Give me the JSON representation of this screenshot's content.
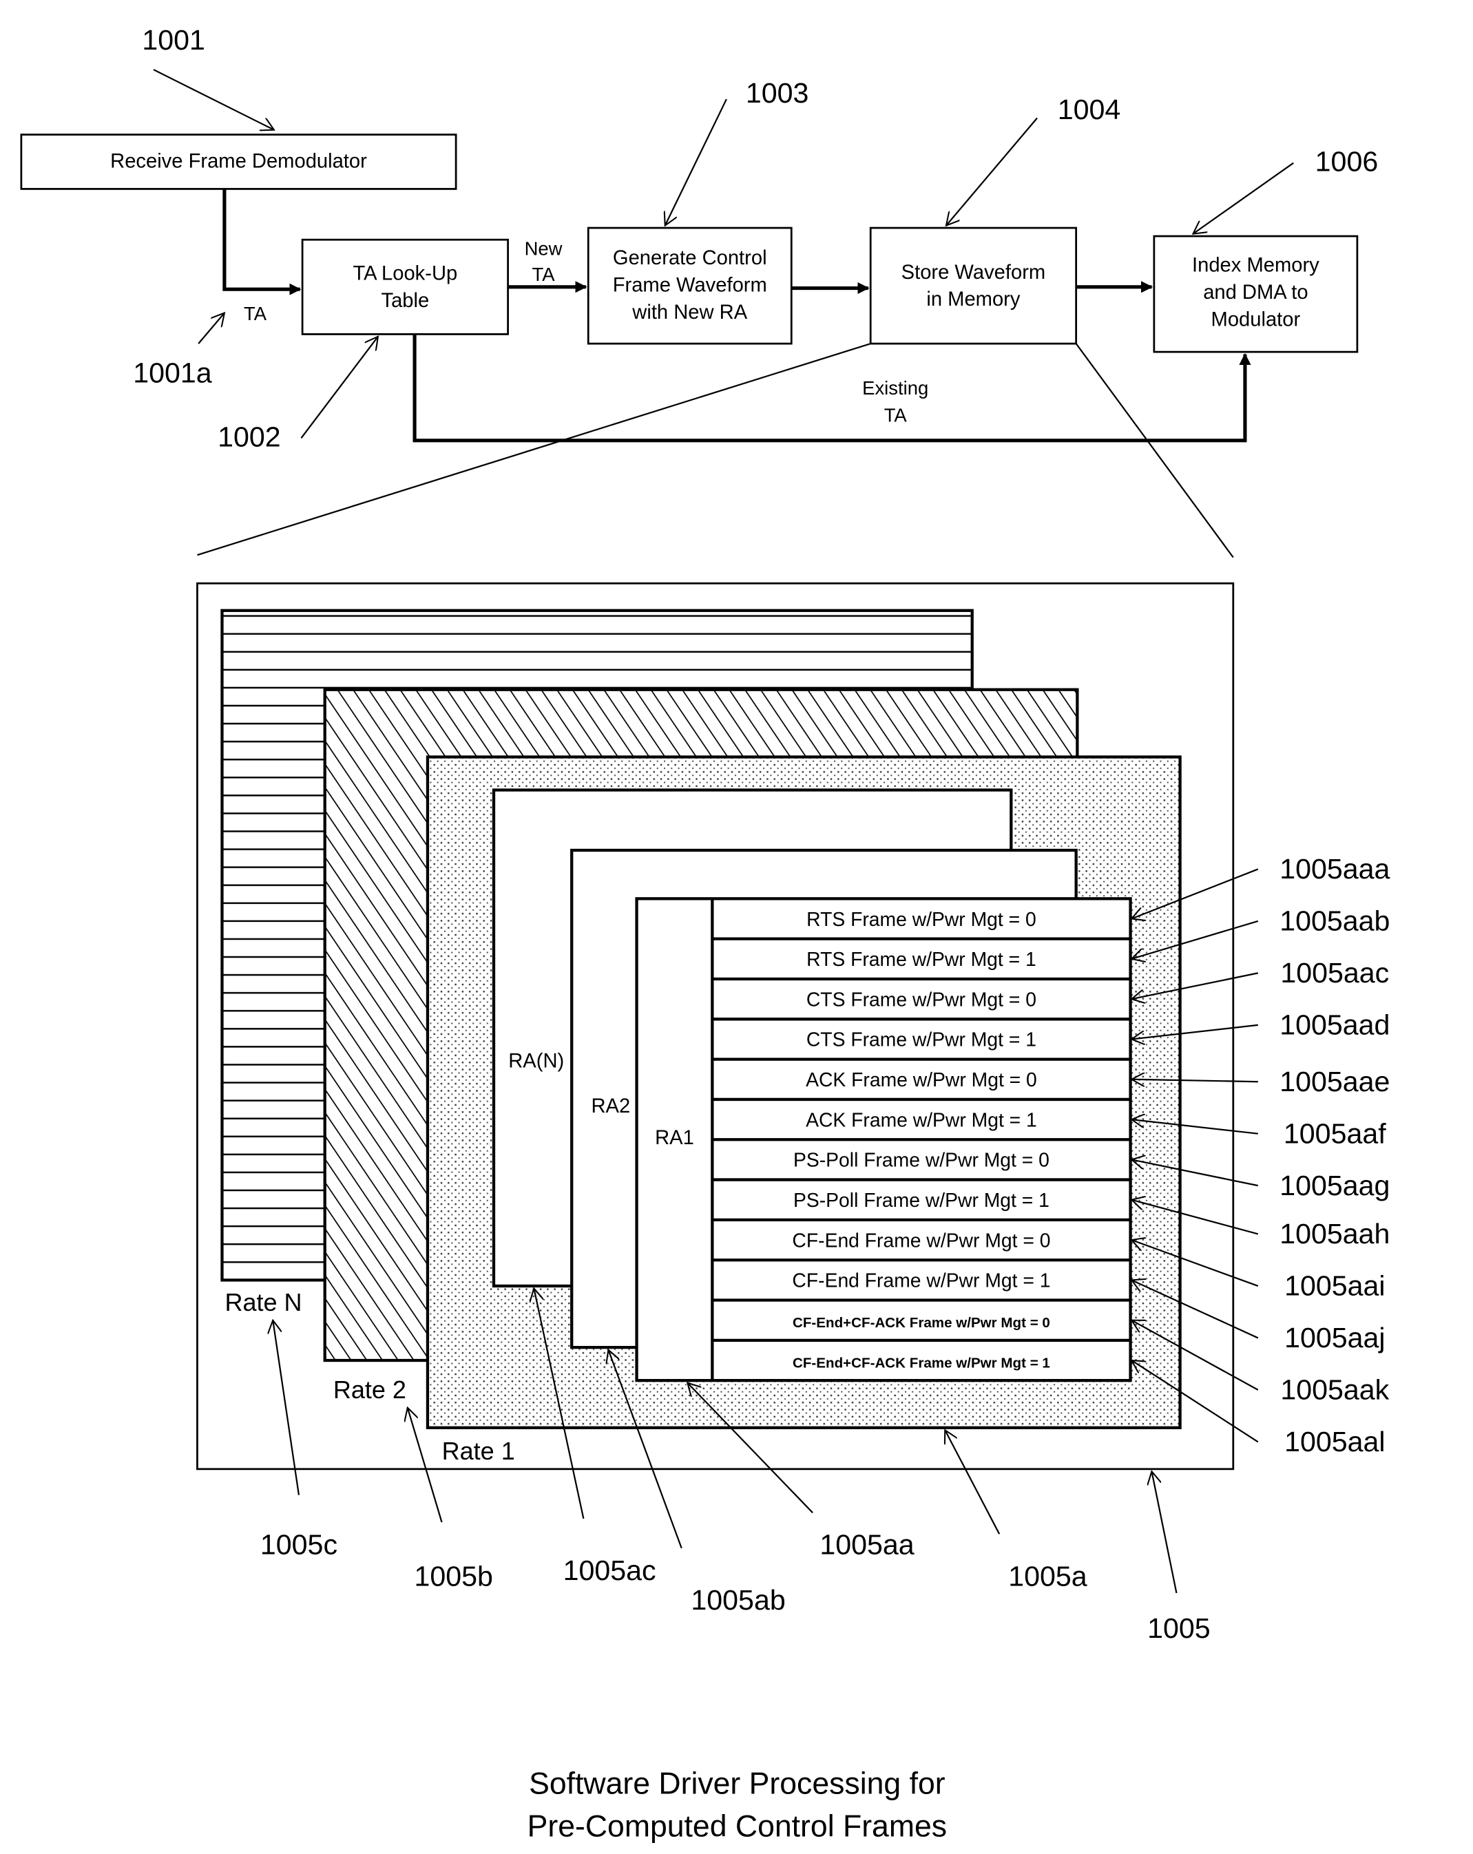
{
  "caption": {
    "line1": "Software Driver Processing for",
    "line2": "Pre-Computed Control Frames"
  },
  "flow": {
    "blocks": [
      {
        "id": "1001",
        "label_lines": [
          "Receive Frame Demodulator"
        ]
      },
      {
        "id": "1002",
        "label_lines": [
          "TA Look-Up",
          "Table"
        ]
      },
      {
        "id": "1003",
        "label_lines": [
          "Generate Control",
          "Frame Waveform",
          "with New RA"
        ]
      },
      {
        "id": "1004",
        "label_lines": [
          "Store Waveform",
          "in Memory"
        ]
      },
      {
        "id": "1006",
        "label_lines": [
          "Index Memory",
          "and DMA to",
          "Modulator"
        ]
      }
    ],
    "edge_labels": {
      "ta_in": "TA",
      "new_ta_1": "New",
      "new_ta_2": "TA",
      "existing_1": "Existing",
      "existing_2": "TA"
    },
    "refs": {
      "r1001": "1001",
      "r1001a": "1001a",
      "r1002": "1002",
      "r1003": "1003",
      "r1004": "1004",
      "r1006": "1006"
    }
  },
  "memory": {
    "rates": {
      "rate_n": "Rate N",
      "rate_2": "Rate 2",
      "rate_1": "Rate 1"
    },
    "ra_labels": {
      "ra_n": "RA(N)",
      "ra_2": "RA2",
      "ra_1": "RA1"
    },
    "rows": [
      {
        "label": "RTS Frame w/Pwr Mgt = 0",
        "ref": "1005aaa"
      },
      {
        "label": "RTS Frame w/Pwr Mgt = 1",
        "ref": "1005aab"
      },
      {
        "label": "CTS Frame w/Pwr Mgt = 0",
        "ref": "1005aac"
      },
      {
        "label": "CTS Frame w/Pwr Mgt = 1",
        "ref": "1005aad"
      },
      {
        "label": "ACK Frame w/Pwr Mgt = 0",
        "ref": "1005aae"
      },
      {
        "label": "ACK Frame w/Pwr Mgt = 1",
        "ref": "1005aaf"
      },
      {
        "label": "PS-Poll Frame w/Pwr Mgt = 0",
        "ref": "1005aag"
      },
      {
        "label": "PS-Poll Frame w/Pwr Mgt = 1",
        "ref": "1005aah"
      },
      {
        "label": "CF-End Frame w/Pwr Mgt = 0",
        "ref": "1005aai"
      },
      {
        "label": "CF-End Frame w/Pwr Mgt = 1",
        "ref": "1005aaj"
      },
      {
        "label": "CF-End+CF-ACK Frame w/Pwr Mgt = 0",
        "ref": "1005aak"
      },
      {
        "label": "CF-End+CF-ACK Frame w/Pwr Mgt = 1",
        "ref": "1005aal"
      }
    ],
    "refs": {
      "r1005c": "1005c",
      "r1005b": "1005b",
      "r1005ac": "1005ac",
      "r1005ab": "1005ab",
      "r1005aa": "1005aa",
      "r1005a": "1005a",
      "r1005": "1005"
    }
  }
}
